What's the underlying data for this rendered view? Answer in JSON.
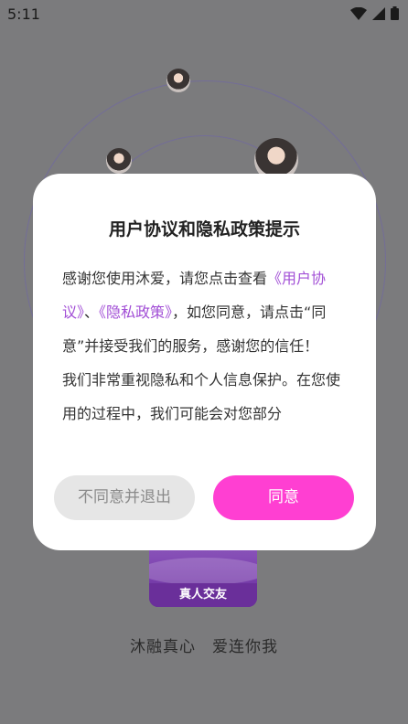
{
  "status": {
    "time": "5:11"
  },
  "dialog": {
    "title": "用户协议和隐私政策提示",
    "body": {
      "p1_a": "感谢您使用沐爱，请您点击查看",
      "link_user": "《用户协议》",
      "sep": "、",
      "link_privacy": "《隐私政策》",
      "p1_b": "，如您同意，请点击“同意”并接受我们的服务，感谢您的信任！",
      "p2": "我们非常重视隐私和个人信息保护。在您使用的过程中，我们可能会对您部分"
    },
    "decline_label": "不同意并退出",
    "agree_label": "同意"
  },
  "logo": {
    "label": "真人交友"
  },
  "slogan": "沐融真心　爱连你我",
  "colors": {
    "link": "#a24fd6",
    "agree": "#ff3fd2",
    "decline_bg": "#e6e6e6"
  }
}
